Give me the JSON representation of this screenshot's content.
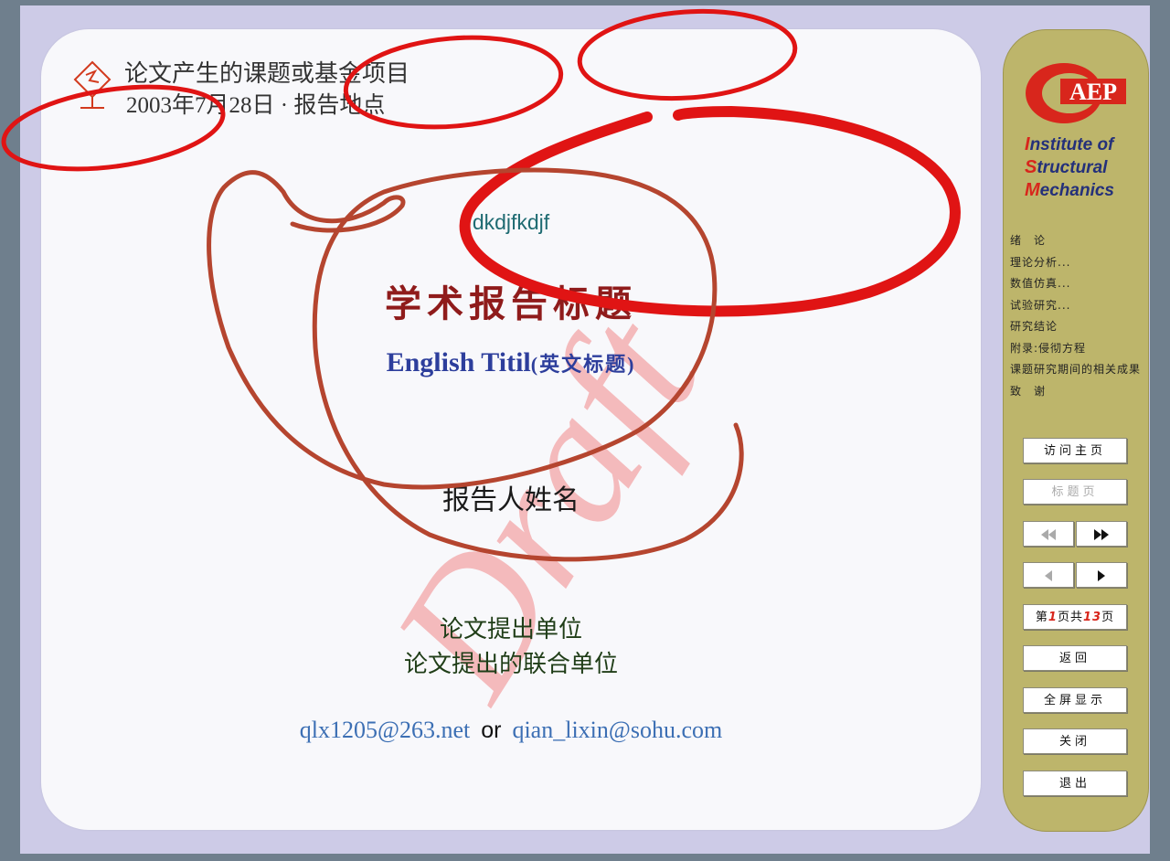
{
  "header": {
    "topic": "论文产生的课题或基金项目",
    "date_location": "2003年7月28日 · 报告地点"
  },
  "slide": {
    "subtitle_text": "dkdjfkdjf",
    "main_title": "学术报告标题",
    "english_title": "English Titil",
    "english_title_cn": "(英文标题)",
    "reporter": "报告人姓名",
    "institution_1": "论文提出单位",
    "institution_2": "论文提出的联合单位",
    "email_1": "qlx1205@263.net",
    "email_or": "or",
    "email_2": "qian_lixin@sohu.com",
    "watermark": "Draft"
  },
  "sidebar": {
    "logo_text": "AEP",
    "institute_lines": [
      {
        "cap": "I",
        "rest": "nstitute of"
      },
      {
        "cap": "S",
        "rest": "tructural"
      },
      {
        "cap": "M",
        "rest": "echanics"
      }
    ],
    "toc": [
      "绪　论",
      "理论分析...",
      "数值仿真...",
      "试验研究...",
      "研究结论",
      "附录:侵彻方程",
      "课题研究期间的相关成果",
      "致　谢"
    ],
    "buttons": {
      "home": "访问主页",
      "title_page": "标题页",
      "back": "返回",
      "fullscreen": "全屏显示",
      "close": "关闭",
      "quit": "退出"
    },
    "pager": {
      "prefix": "第",
      "current": "1",
      "middle": "页共",
      "total": "13",
      "suffix": "页"
    }
  },
  "colors": {
    "slide_bg": "#f8f8fb",
    "frame_bg": "#cdcbe7",
    "sidebar_bg": "#bdb56b",
    "annotation_red": "#e01414",
    "annotation_brown": "#b5452f",
    "title_red": "#8f1b1b",
    "english_blue": "#2d3e9c"
  },
  "icons": [
    "road-sign-icon",
    "rewind-icon",
    "fast-forward-icon",
    "prev-triangle-icon",
    "next-triangle-icon"
  ]
}
